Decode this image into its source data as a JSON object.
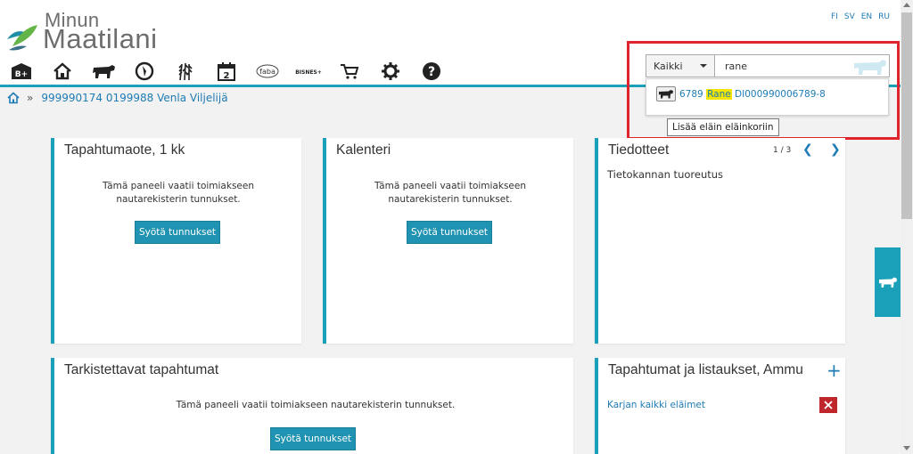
{
  "logo": {
    "line1": "Minun",
    "line2": "Maatilani"
  },
  "languages": [
    "FI",
    "SV",
    "EN",
    "RU"
  ],
  "toolbar": {
    "items": [
      {
        "icon": "b-plus-icon",
        "label": "B+"
      },
      {
        "icon": "home-icon"
      },
      {
        "icon": "cow-icon"
      },
      {
        "icon": "compass-icon"
      },
      {
        "icon": "wheat-icon"
      },
      {
        "icon": "calendar-icon",
        "label": "2"
      },
      {
        "icon": "faba-logo",
        "label": "faba"
      },
      {
        "icon": "bisnes-logo",
        "label": "BISNES+"
      },
      {
        "icon": "cart-icon"
      },
      {
        "icon": "gear-icon"
      },
      {
        "icon": "help-icon"
      }
    ]
  },
  "breadcrumb": {
    "separator": "»",
    "farm": "999990174 0199988 Venla Viljelijä"
  },
  "search": {
    "category": "Kaikki",
    "query": "rane",
    "result": {
      "number": "6789",
      "name": "Rane",
      "id": "DI000990006789-8"
    },
    "tooltip": "Lisää eläin eläinkoriin"
  },
  "panels": {
    "tapahtumaote": {
      "title": "Tapahtumaote, 1 kk",
      "message": "Tämä paneeli vaatii toimiakseen nautarekisterin tunnukset.",
      "button": "Syötä tunnukset"
    },
    "kalenteri": {
      "title": "Kalenteri",
      "message": "Tämä paneeli vaatii toimiakseen nautarekisterin tunnukset.",
      "button": "Syötä tunnukset"
    },
    "tiedotteet": {
      "title": "Tiedotteet",
      "pager": "1 / 3",
      "subtitle": "Tietokannan tuoreutus"
    },
    "tarkistettavat": {
      "title": "Tarkistettavat tapahtumat",
      "message": "Tämä paneeli vaatii toimiakseen nautarekisterin tunnukset.",
      "button": "Syötä tunnukset"
    },
    "tapahtumat_listaukset": {
      "title": "Tapahtumat ja listaukset, Ammu",
      "link": "Karjan kaikki eläimet"
    }
  },
  "colors": {
    "accent": "#1aa0b8",
    "link": "#1f7bb5",
    "button": "#1f93b1",
    "highlight": "#f3e500",
    "annotation": "#e0232c",
    "delete": "#c0272d"
  }
}
